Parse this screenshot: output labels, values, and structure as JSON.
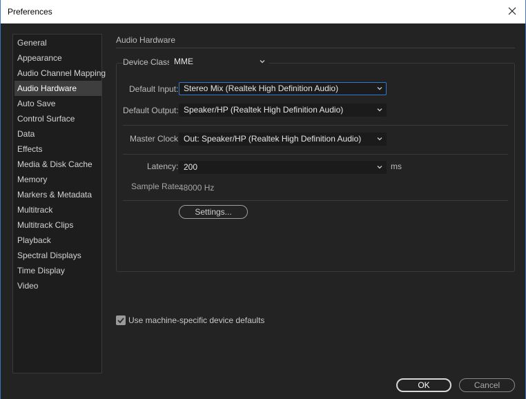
{
  "window": {
    "title": "Preferences",
    "close_icon": "close-icon"
  },
  "sidebar": {
    "items": [
      {
        "label": "General"
      },
      {
        "label": "Appearance"
      },
      {
        "label": "Audio Channel Mapping"
      },
      {
        "label": "Audio Hardware",
        "active": true
      },
      {
        "label": "Auto Save"
      },
      {
        "label": "Control Surface"
      },
      {
        "label": "Data"
      },
      {
        "label": "Effects"
      },
      {
        "label": "Media & Disk Cache"
      },
      {
        "label": "Memory"
      },
      {
        "label": "Markers & Metadata"
      },
      {
        "label": "Multitrack"
      },
      {
        "label": "Multitrack Clips"
      },
      {
        "label": "Playback"
      },
      {
        "label": "Spectral Displays"
      },
      {
        "label": "Time Display"
      },
      {
        "label": "Video"
      }
    ]
  },
  "main": {
    "section_title": "Audio Hardware",
    "device_class": {
      "label": "Device Class:",
      "value": "MME"
    },
    "default_input": {
      "label": "Default Input:",
      "value": "Stereo Mix (Realtek High Definition Audio)"
    },
    "default_output": {
      "label": "Default Output:",
      "value": "Speaker/HP (Realtek High Definition Audio)"
    },
    "master_clock": {
      "label": "Master Clock:",
      "value": "Out: Speaker/HP (Realtek High Definition Audio)"
    },
    "latency": {
      "label": "Latency:",
      "value": "200",
      "unit": "ms"
    },
    "sample_rate": {
      "label": "Sample Rate:",
      "value": "48000 Hz"
    },
    "settings_button": "Settings..."
  },
  "footer": {
    "checkbox_label": "Use machine-specific device defaults",
    "checkbox_checked": true,
    "ok": "OK",
    "cancel": "Cancel"
  },
  "colors": {
    "accent": "#2f7bd0",
    "background": "#232323",
    "active_item": "#3e3e3e"
  }
}
